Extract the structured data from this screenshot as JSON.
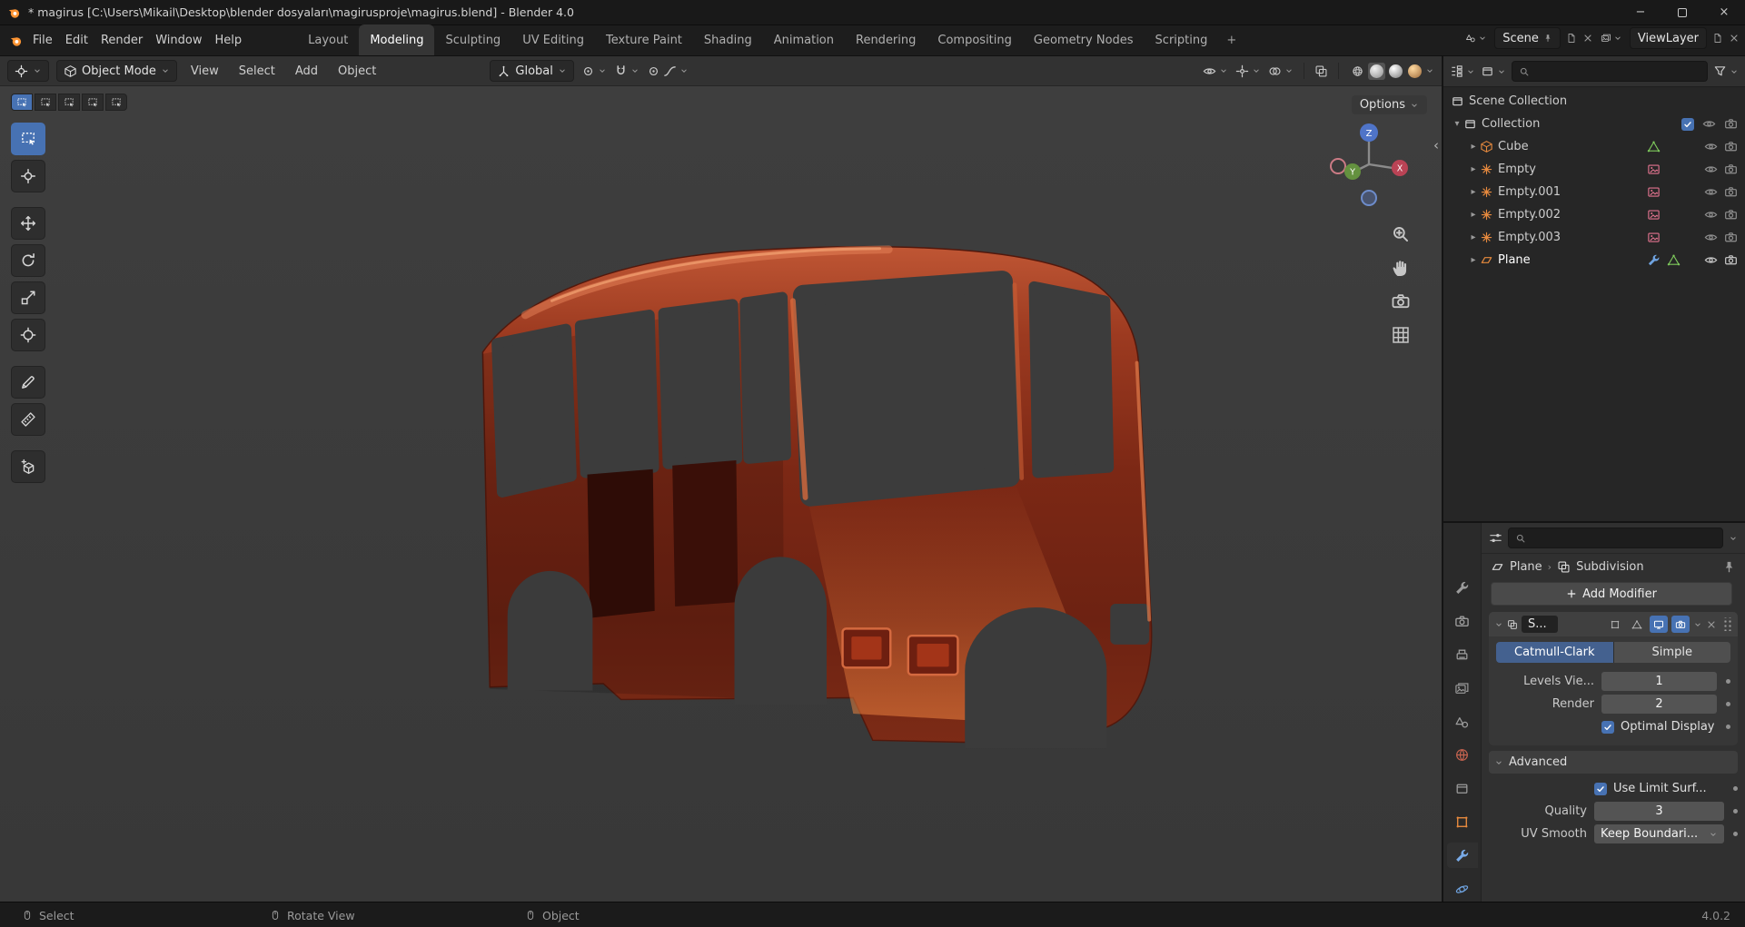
{
  "colors": {
    "accent": "#4772b3",
    "viewport_bg": "#3b3b3b",
    "bus_body": "#8a2f1b",
    "bus_highlight": "#cc5a35",
    "bus_shadow": "#431208"
  },
  "title_bar": {
    "title": "* magirus [C:\\Users\\Mikail\\Desktop\\blender dosyaları\\magirusproje\\magirus.blend] - Blender 4.0"
  },
  "topbar": {
    "menus": [
      "File",
      "Edit",
      "Render",
      "Window",
      "Help"
    ],
    "tabs": [
      {
        "label": "Layout"
      },
      {
        "label": "Modeling"
      },
      {
        "label": "Sculpting"
      },
      {
        "label": "UV Editing"
      },
      {
        "label": "Texture Paint"
      },
      {
        "label": "Shading"
      },
      {
        "label": "Animation"
      },
      {
        "label": "Rendering"
      },
      {
        "label": "Compositing"
      },
      {
        "label": "Geometry Nodes"
      },
      {
        "label": "Scripting"
      }
    ],
    "new_workspace": "+",
    "scene_label": "Scene",
    "view_layer_label": "ViewLayer"
  },
  "viewport": {
    "header": {
      "mode": "Object Mode",
      "menus": [
        "View",
        "Select",
        "Add",
        "Object"
      ],
      "orientation": "Global"
    },
    "options_label": "Options",
    "gizmo": {
      "x": "X",
      "y": "Y",
      "z": "Z"
    }
  },
  "outliner": {
    "root": "Scene Collection",
    "collection": "Collection",
    "items": [
      {
        "label": "Cube"
      },
      {
        "label": "Empty"
      },
      {
        "label": "Empty.001"
      },
      {
        "label": "Empty.002"
      },
      {
        "label": "Empty.003"
      },
      {
        "label": "Plane"
      }
    ]
  },
  "properties": {
    "breadcrumb": {
      "object": "Plane",
      "modifier": "Subdivision"
    },
    "add_modifier": "Add Modifier",
    "modifier": {
      "name": "S...",
      "catmull": "Catmull-Clark",
      "simple": "Simple",
      "rows": {
        "levels_label": "Levels Vie...",
        "levels_value": "1",
        "render_label": "Render",
        "render_value": "2",
        "optimal_label": "Optimal Display",
        "advanced_label": "Advanced",
        "limit_label": "Use Limit Surf...",
        "quality_label": "Quality",
        "quality_value": "3",
        "uv_label": "UV Smooth",
        "uv_value": "Keep Boundari..."
      }
    }
  },
  "status_bar": {
    "select": "Select",
    "rotate": "Rotate View",
    "object": "Object",
    "version": "4.0.2"
  }
}
